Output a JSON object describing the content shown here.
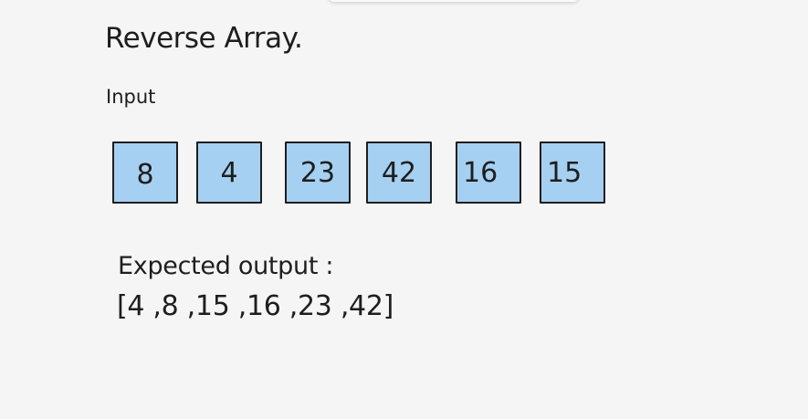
{
  "title": "Reverse Array.",
  "input_label": "Input",
  "array": [
    "8",
    "4",
    "23",
    "42",
    "16",
    "15"
  ],
  "expected_label": "Expected output :",
  "expected_value": "[4 ,8 ,15 ,16 ,23 ,42]",
  "colors": {
    "background": "#f5f5f5",
    "cell_fill": "#a5d0f1",
    "stroke": "#1e1e1e"
  }
}
